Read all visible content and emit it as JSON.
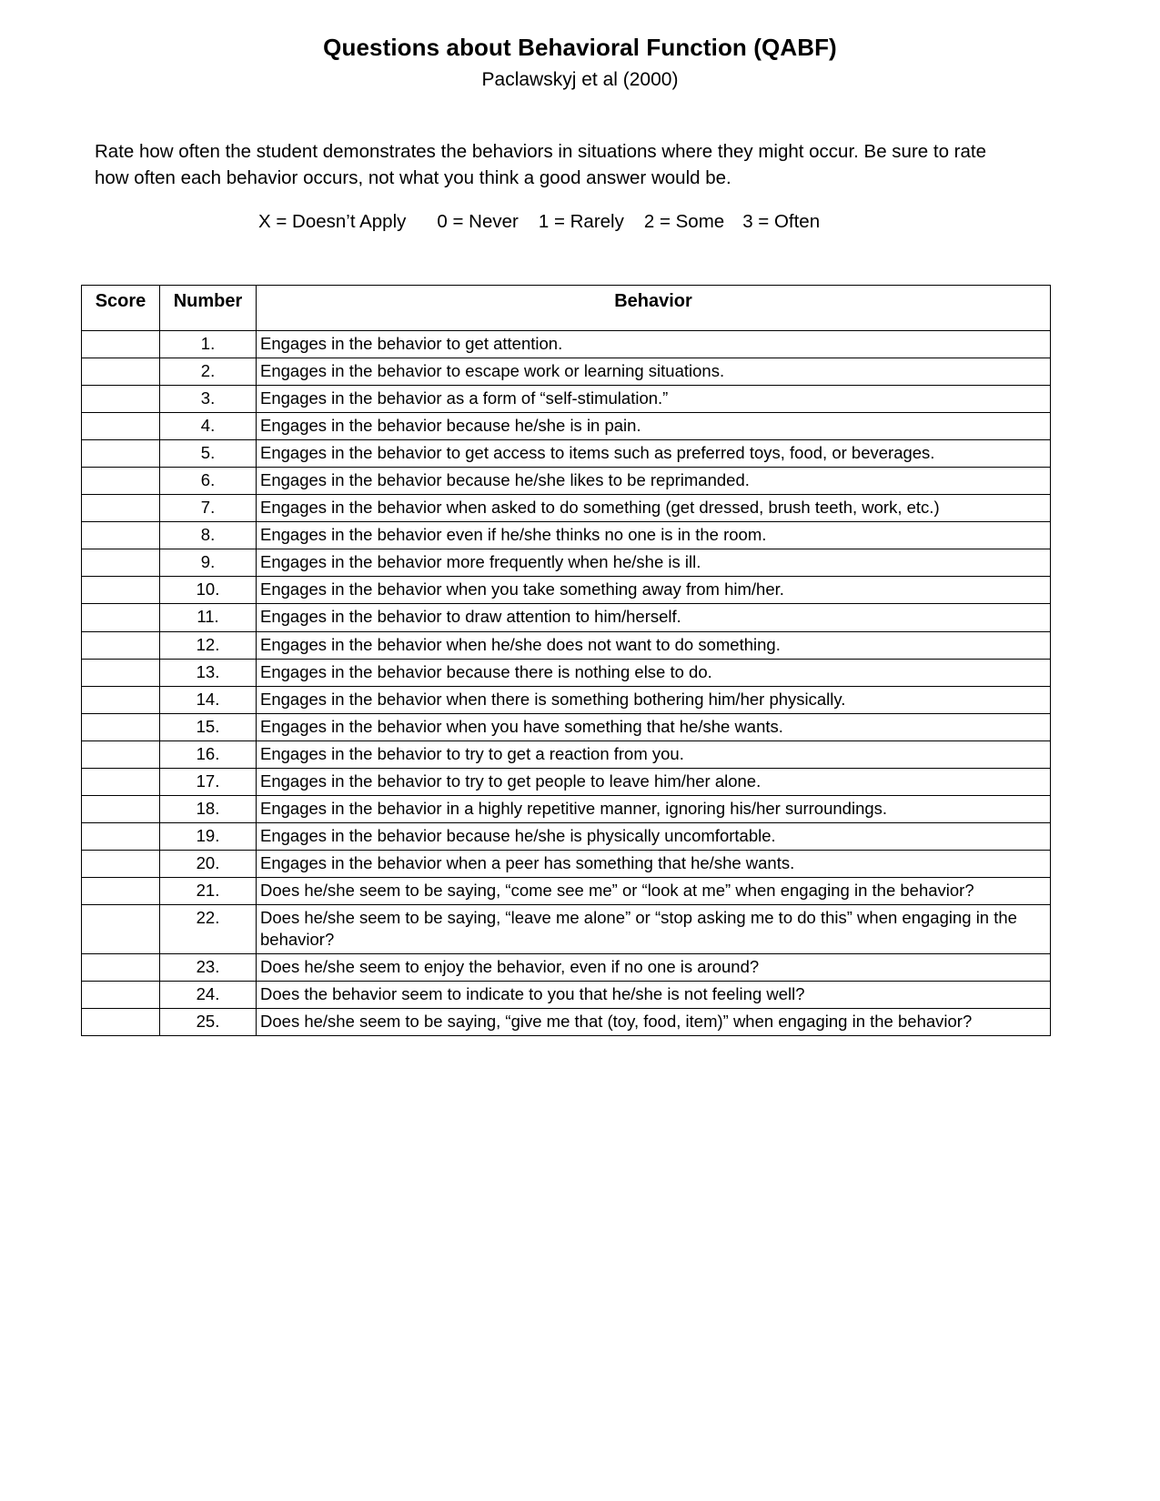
{
  "document": {
    "title": "Questions about Behavioral Function (QABF)",
    "subtitle": "Paclawskyj et al (2000)",
    "instructions": "Rate how often the student demonstrates the behaviors in situations where they might occur.  Be sure to rate how often each behavior occurs, not what you think a good answer would be."
  },
  "scale": {
    "items": [
      "X = Doesn’t Apply",
      "0 = Never",
      "1 = Rarely",
      "2 = Some",
      "3 = Often"
    ]
  },
  "table": {
    "headers": {
      "score": "Score",
      "number": "Number",
      "behavior": "Behavior"
    },
    "rows": [
      {
        "score": "",
        "number": "1.",
        "behavior": "Engages in the behavior to get attention."
      },
      {
        "score": "",
        "number": "2.",
        "behavior": "Engages in the behavior to escape work or learning situations."
      },
      {
        "score": "",
        "number": "3.",
        "behavior": "Engages in the behavior as a form of “self-stimulation.”"
      },
      {
        "score": "",
        "number": "4.",
        "behavior": "Engages in the behavior because he/she is in pain."
      },
      {
        "score": "",
        "number": "5.",
        "behavior": "Engages in the behavior to get access to items such as preferred toys, food, or beverages."
      },
      {
        "score": "",
        "number": "6.",
        "behavior": "Engages in the behavior because he/she likes to be reprimanded."
      },
      {
        "score": "",
        "number": "7.",
        "behavior": "Engages in the behavior when asked to do something (get dressed, brush teeth, work, etc.)"
      },
      {
        "score": "",
        "number": "8.",
        "behavior": "Engages in the behavior even if he/she thinks no one is in the room."
      },
      {
        "score": "",
        "number": "9.",
        "behavior": "Engages in the behavior more frequently when he/she is ill."
      },
      {
        "score": "",
        "number": "10.",
        "behavior": "Engages in the behavior when you take something away from him/her."
      },
      {
        "score": "",
        "number": "11.",
        "behavior": "Engages in the behavior to draw attention to him/herself."
      },
      {
        "score": "",
        "number": "12.",
        "behavior": "Engages in the behavior when he/she does not want to do something."
      },
      {
        "score": "",
        "number": "13.",
        "behavior": "Engages in the behavior because there is nothing else to do."
      },
      {
        "score": "",
        "number": "14.",
        "behavior": "Engages in the behavior when there is something bothering him/her physically."
      },
      {
        "score": "",
        "number": "15.",
        "behavior": "Engages in the behavior when you have something that he/she wants."
      },
      {
        "score": "",
        "number": "16.",
        "behavior": "Engages in the behavior to try to get a reaction from you."
      },
      {
        "score": "",
        "number": "17.",
        "behavior": "Engages in the behavior to try to get people to leave him/her alone."
      },
      {
        "score": "",
        "number": "18.",
        "behavior": "Engages in the behavior in a highly repetitive manner, ignoring his/her surroundings."
      },
      {
        "score": "",
        "number": "19.",
        "behavior": "Engages in the behavior because he/she is physically uncomfortable."
      },
      {
        "score": "",
        "number": "20.",
        "behavior": "Engages in the behavior when a peer has something that he/she wants."
      },
      {
        "score": "",
        "number": "21.",
        "behavior": "Does he/she seem to be saying, “come see me” or “look at me” when engaging in the behavior?"
      },
      {
        "score": "",
        "number": "22.",
        "behavior": "Does he/she seem to be saying, “leave me alone” or “stop asking me to do this” when engaging in the behavior?"
      },
      {
        "score": "",
        "number": "23.",
        "behavior": "Does he/she seem to enjoy the behavior, even if no one is around?"
      },
      {
        "score": "",
        "number": "24.",
        "behavior": "Does the behavior seem to indicate to you that he/she is not feeling well?"
      },
      {
        "score": "",
        "number": "25.",
        "behavior": "Does he/she seem to be saying, “give me that (toy, food, item)” when engaging in the behavior?"
      }
    ]
  }
}
